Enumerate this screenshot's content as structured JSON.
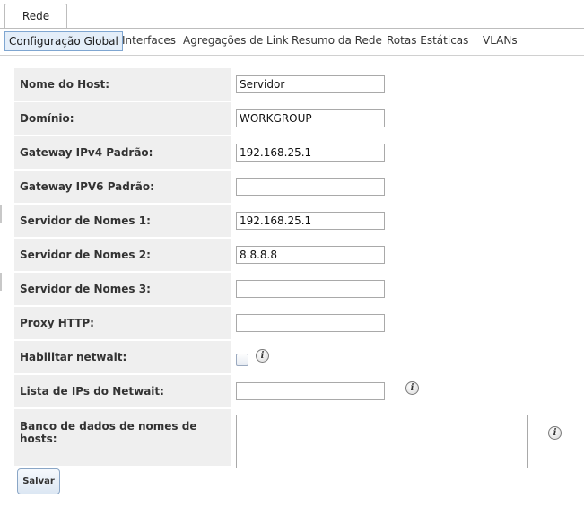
{
  "top_tab": {
    "label": "Rede"
  },
  "subtabs": [
    {
      "label": "Configuração Global",
      "active": true
    },
    {
      "label": "Interfaces",
      "active": false
    },
    {
      "label": "Agregações de Link",
      "active": false
    },
    {
      "label": "Resumo da Rede",
      "active": false
    },
    {
      "label": "Rotas Estáticas",
      "active": false
    },
    {
      "label": "VLANs",
      "active": false
    }
  ],
  "form": {
    "rows": [
      {
        "label": "Nome do Host:",
        "value": "Servidor"
      },
      {
        "label": "Domínio:",
        "value": "WORKGROUP"
      },
      {
        "label": "Gateway IPv4 Padrão:",
        "value": "192.168.25.1"
      },
      {
        "label": "Gateway IPV6 Padrão:",
        "value": ""
      },
      {
        "label": "Servidor de Nomes 1:",
        "value": "192.168.25.1"
      },
      {
        "label": "Servidor de Nomes 2:",
        "value": "8.8.8.8"
      },
      {
        "label": "Servidor de Nomes 3:",
        "value": ""
      },
      {
        "label": "Proxy HTTP:",
        "value": ""
      },
      {
        "label": "Habilitar netwait:",
        "checked": false
      },
      {
        "label": "Lista de IPs do Netwait:",
        "value": ""
      },
      {
        "label": "Banco de dados de nomes de hosts:",
        "value": ""
      }
    ],
    "info_icon_glyph": "i",
    "save_label": "Salvar"
  },
  "icons": {
    "info": "info-icon"
  }
}
